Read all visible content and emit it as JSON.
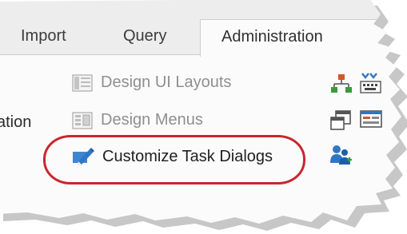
{
  "tabs": [
    {
      "label": "Import"
    },
    {
      "label": "Query"
    },
    {
      "label": "Administration",
      "active": true
    }
  ],
  "ribbon": {
    "partial_left_label": "ation",
    "items": [
      {
        "label": "Design UI Layouts",
        "icon": "layout-icon",
        "enabled": false
      },
      {
        "label": "Design Menus",
        "icon": "menu-icon",
        "enabled": false
      },
      {
        "label": "Customize Task Dialogs",
        "icon": "pencil-icon",
        "enabled": true,
        "highlighted": true
      }
    ],
    "right_icons": [
      "org-chart-icon",
      "keyboard-icon",
      "window-copy-icon",
      "form-icon",
      "users-icon"
    ]
  },
  "colors": {
    "highlight_ring": "#c8262e",
    "accent_blue": "#2f77c6",
    "accent_orange": "#d2572a"
  }
}
